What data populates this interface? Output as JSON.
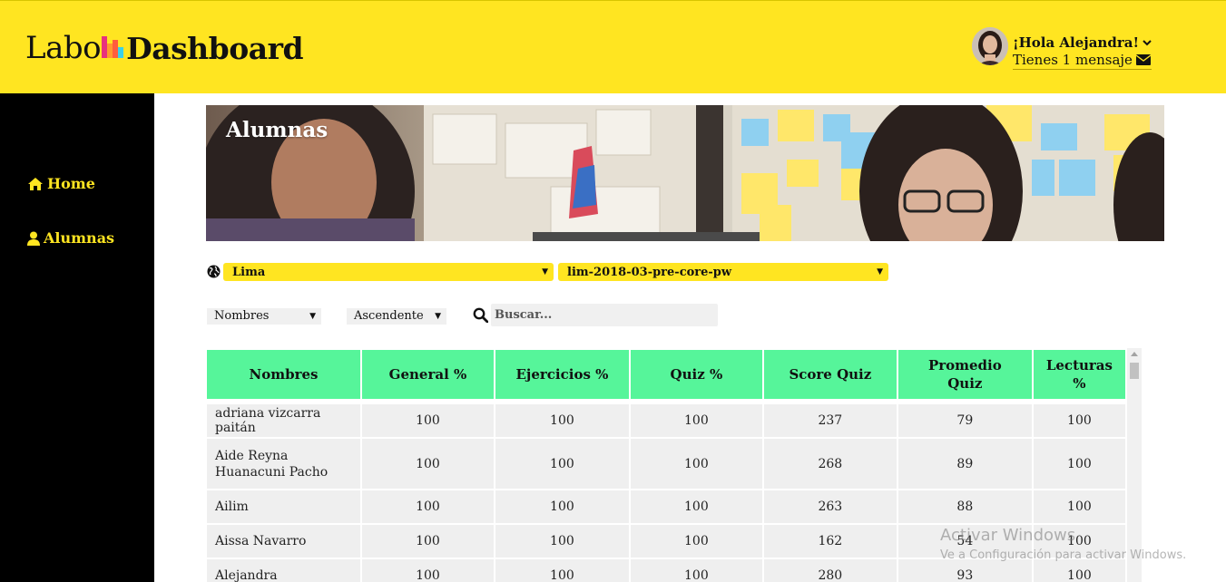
{
  "header": {
    "logo_left": "Labo",
    "logo_right": "Dashboard",
    "greeting": "¡Hola Alejandra!",
    "messages": "Tienes 1 mensaje"
  },
  "sidebar": {
    "items": [
      {
        "label": "Home",
        "icon": "home-icon"
      },
      {
        "label": "Alumnas",
        "icon": "user-icon"
      }
    ]
  },
  "banner": {
    "title": "Alumnas"
  },
  "filters": {
    "sede": "Lima",
    "cohort": "lim-2018-03-pre-core-pw",
    "sort_by": "Nombres",
    "order": "Ascendente",
    "search_placeholder": "Buscar..."
  },
  "table": {
    "columns": [
      "Nombres",
      "General %",
      "Ejercicios %",
      "Quiz %",
      "Score Quiz",
      "Promedio Quiz",
      "Lecturas %"
    ],
    "rows": [
      {
        "name": "adriana vizcarra paitán",
        "general": "100",
        "ejercicios": "100",
        "quiz": "100",
        "score": "237",
        "promedio": "79",
        "lecturas": "100"
      },
      {
        "name": "Aide Reyna Huanacuni Pacho",
        "general": "100",
        "ejercicios": "100",
        "quiz": "100",
        "score": "268",
        "promedio": "89",
        "lecturas": "100"
      },
      {
        "name": "Ailim",
        "general": "100",
        "ejercicios": "100",
        "quiz": "100",
        "score": "263",
        "promedio": "88",
        "lecturas": "100"
      },
      {
        "name": "Aissa Navarro",
        "general": "100",
        "ejercicios": "100",
        "quiz": "100",
        "score": "162",
        "promedio": "54",
        "lecturas": "100"
      },
      {
        "name": "Alejandra",
        "general": "100",
        "ejercicios": "100",
        "quiz": "100",
        "score": "280",
        "promedio": "93",
        "lecturas": "100"
      }
    ]
  },
  "watermark": {
    "line1": "Activar Windows",
    "line2": "Ve a Configuración para activar Windows."
  },
  "colors": {
    "accent_yellow": "#ffe521",
    "header_green": "#56f59a",
    "sidebar_black": "#000000"
  }
}
